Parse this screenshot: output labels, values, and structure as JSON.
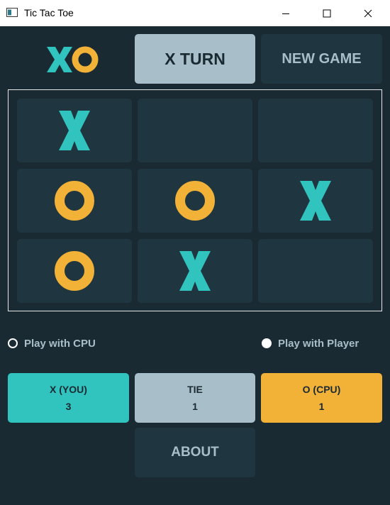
{
  "window": {
    "title": "Tic Tac Toe"
  },
  "colors": {
    "x": "#31c3bd",
    "o": "#f2b137",
    "bg": "#1a2a33",
    "cell": "#1f3641",
    "silver": "#a8bfc9"
  },
  "header": {
    "turn_label": "X TURN",
    "new_game_label": "NEW GAME"
  },
  "board": [
    "X",
    "",
    "",
    "O",
    "O",
    "X",
    "O",
    "X",
    ""
  ],
  "mode": {
    "cpu_label": "Play with CPU",
    "player_label": "Play with Player",
    "selected": "player"
  },
  "scores": {
    "x_label": "X (YOU)",
    "x_value": "3",
    "tie_label": "TIE",
    "tie_value": "1",
    "o_label": "O (CPU)",
    "o_value": "1"
  },
  "about_label": "ABOUT"
}
